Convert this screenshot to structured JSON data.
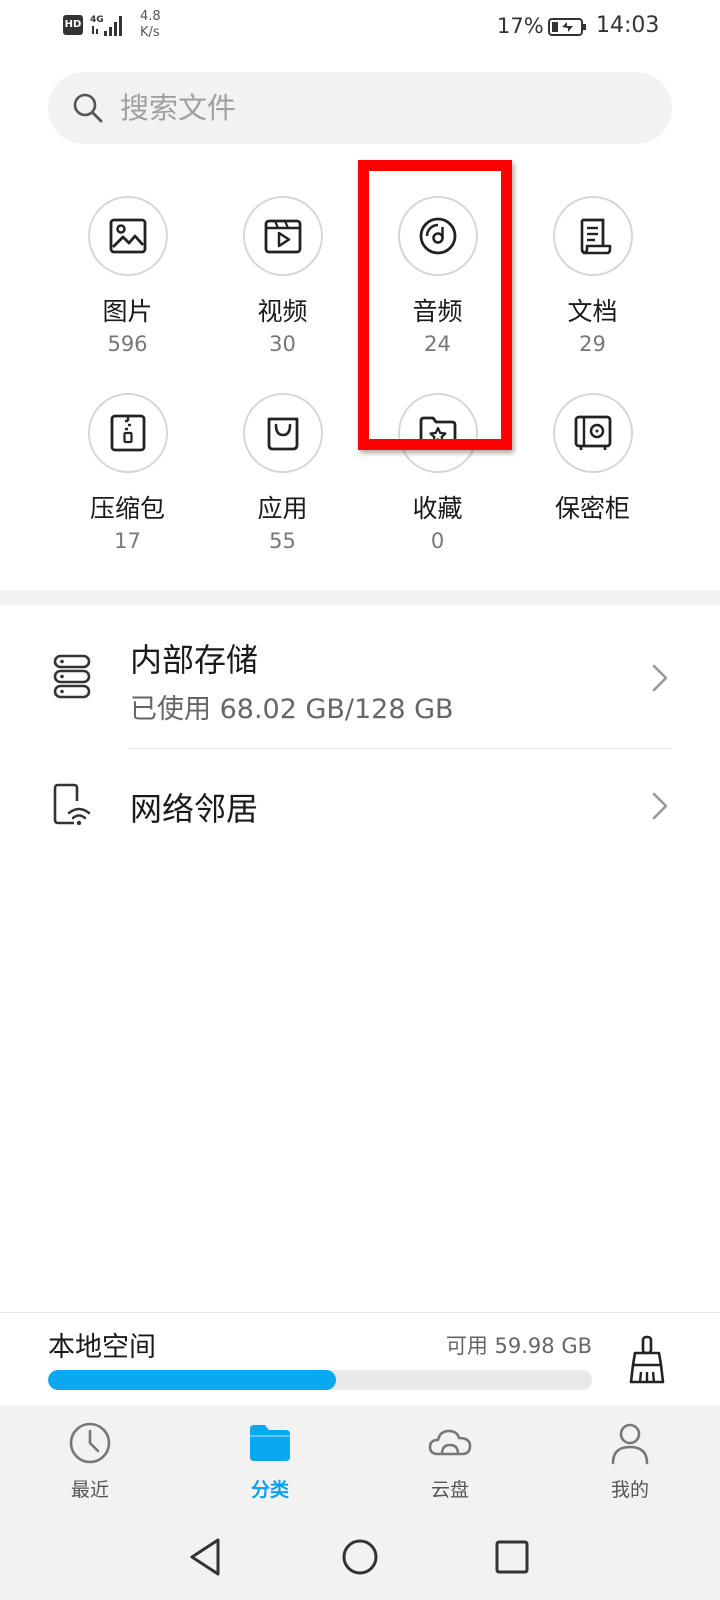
{
  "status_bar": {
    "hd": "HD",
    "network": "4G",
    "speed_value": "4.8",
    "speed_unit": "K/s",
    "battery_percent": "17%",
    "time": "14:03"
  },
  "search": {
    "placeholder": "搜索文件"
  },
  "categories": [
    {
      "label": "图片",
      "count": "596",
      "icon": "image-icon"
    },
    {
      "label": "视频",
      "count": "30",
      "icon": "video-icon"
    },
    {
      "label": "音频",
      "count": "24",
      "icon": "audio-disc-icon"
    },
    {
      "label": "文档",
      "count": "29",
      "icon": "document-scroll-icon"
    },
    {
      "label": "压缩包",
      "count": "17",
      "icon": "zip-icon"
    },
    {
      "label": "应用",
      "count": "55",
      "icon": "shopping-bag-icon"
    },
    {
      "label": "收藏",
      "count": "0",
      "icon": "star-folder-icon"
    },
    {
      "label": "保密柜",
      "count": "",
      "icon": "safe-icon"
    }
  ],
  "storage": {
    "internal_title": "内部存储",
    "internal_usage": "已使用 68.02 GB/128 GB",
    "network_title": "网络邻居"
  },
  "local_space": {
    "title": "本地空间",
    "available": "可用 59.98 GB",
    "used_fraction": 0.53
  },
  "tabs": [
    {
      "label": "最近",
      "icon": "clock-icon",
      "active": false
    },
    {
      "label": "分类",
      "icon": "folder-icon",
      "active": true
    },
    {
      "label": "云盘",
      "icon": "cloud-icon",
      "active": false
    },
    {
      "label": "我的",
      "icon": "person-icon",
      "active": false
    }
  ],
  "colors": {
    "accent": "#0aa8f0",
    "highlight_border": "#ff0000"
  }
}
